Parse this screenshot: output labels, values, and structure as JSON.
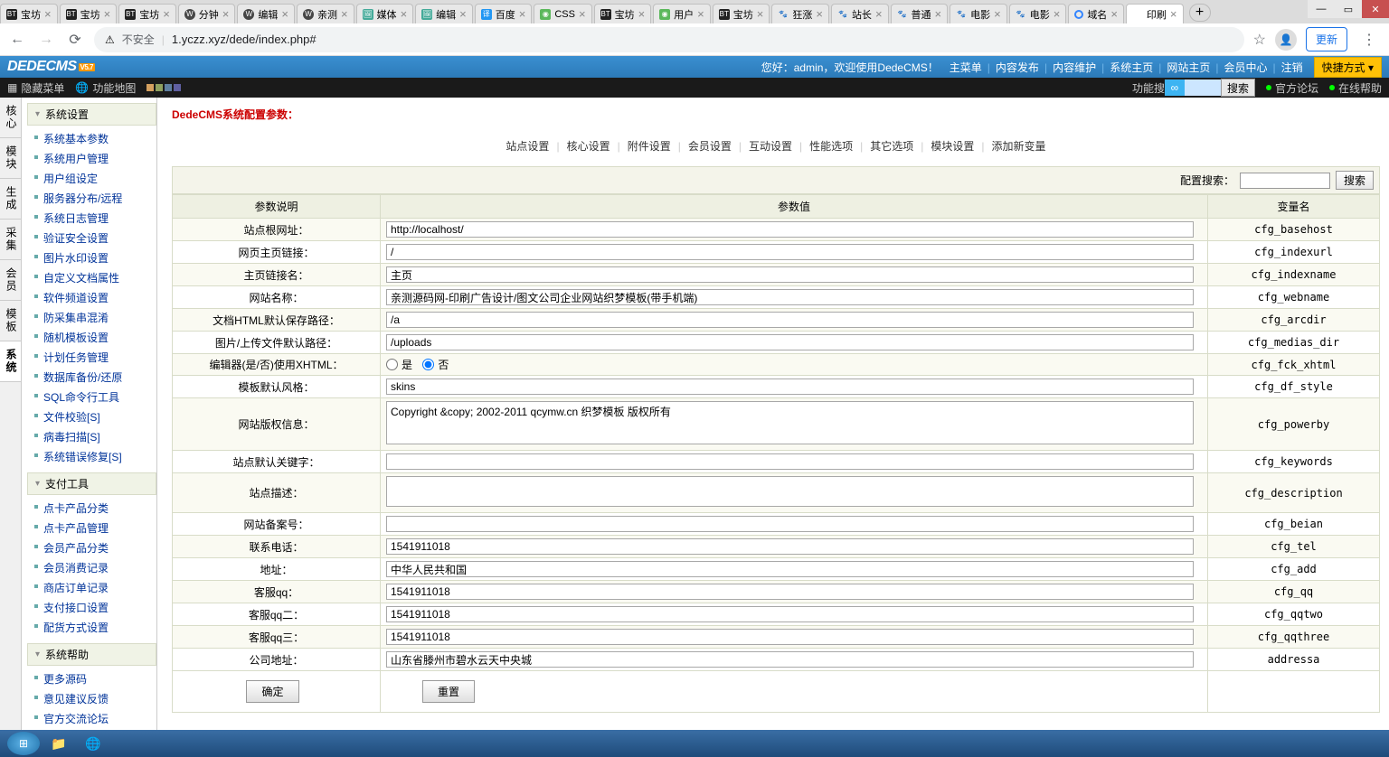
{
  "browser": {
    "tabs": [
      {
        "icon": "bt",
        "title": "宝坊"
      },
      {
        "icon": "bt",
        "title": "宝坊"
      },
      {
        "icon": "bt",
        "title": "宝坊"
      },
      {
        "icon": "wp",
        "title": "分钟"
      },
      {
        "icon": "wp",
        "title": "编辑"
      },
      {
        "icon": "wp",
        "title": "亲测"
      },
      {
        "icon": "img",
        "title": "媒体"
      },
      {
        "icon": "img",
        "title": "编辑"
      },
      {
        "icon": "blue",
        "title": "百度"
      },
      {
        "icon": "green",
        "title": "CSS"
      },
      {
        "icon": "bt",
        "title": "宝坊"
      },
      {
        "icon": "green",
        "title": "用户"
      },
      {
        "icon": "bt",
        "title": "宝坊"
      },
      {
        "icon": "paw",
        "title": "狂涨"
      },
      {
        "icon": "paw",
        "title": "站长"
      },
      {
        "icon": "paw",
        "title": "普通"
      },
      {
        "icon": "paw",
        "title": "电影"
      },
      {
        "icon": "paw",
        "title": "电影"
      },
      {
        "icon": "ring",
        "title": "域名"
      },
      {
        "icon": "",
        "title": "印刷",
        "active": true
      }
    ],
    "insecure_label": "不安全",
    "url": "1.yczz.xyz/dede/index.php#",
    "update_label": "更新"
  },
  "top": {
    "logo_main": "DEDECMS",
    "logo_sub": "V5.7",
    "welcome_prefix": "您好：",
    "user": "admin",
    "welcome_suffix": "，欢迎使用DedeCMS！",
    "links": [
      "主菜单",
      "内容发布",
      "内容维护",
      "系统主页",
      "网站主页",
      "会员中心",
      "注销"
    ],
    "quick": "快捷方式 ▾"
  },
  "toolbar": {
    "hide_menu": "隐藏菜单",
    "sitemap": "功能地图",
    "search_label": "功能搜",
    "search_btn": "搜索",
    "forum": "官方论坛",
    "help": "在线帮助"
  },
  "side_tabs": [
    "核心",
    "模块",
    "生成",
    "采集",
    "会员",
    "模板",
    "系统"
  ],
  "side_active": 6,
  "left_menu": [
    {
      "title": "系统设置",
      "items": [
        "系统基本参数",
        "系统用户管理",
        "用户组设定",
        "服务器分布/远程",
        "系统日志管理",
        "验证安全设置",
        "图片水印设置",
        "自定义文档属性",
        "软件频道设置",
        "防采集串混淆",
        "随机模板设置",
        "计划任务管理",
        "数据库备份/还原",
        "SQL命令行工具",
        "文件校验[S]",
        "病毒扫描[S]",
        "系统错误修复[S]"
      ]
    },
    {
      "title": "支付工具",
      "items": [
        "点卡产品分类",
        "点卡产品管理",
        "会员产品分类",
        "会员消费记录",
        "商店订单记录",
        "支付接口设置",
        "配货方式设置"
      ]
    },
    {
      "title": "系统帮助",
      "items": [
        "更多源码",
        "意见建议反馈",
        "官方交流论坛"
      ]
    }
  ],
  "main": {
    "crumb": "DedeCMS系统配置参数：",
    "subnav": [
      "站点设置",
      "核心设置",
      "附件设置",
      "会员设置",
      "互动设置",
      "性能选项",
      "其它选项",
      "模块设置",
      "添加新变量"
    ],
    "cfg_search_label": "配置搜索：",
    "cfg_search_btn": "搜索",
    "headers": {
      "desc": "参数说明",
      "val": "参数值",
      "var": "变量名"
    },
    "rows": [
      {
        "desc": "站点根网址：",
        "type": "text",
        "value": "http://localhost/",
        "var": "cfg_basehost"
      },
      {
        "desc": "网页主页链接：",
        "type": "text",
        "value": "/",
        "var": "cfg_indexurl"
      },
      {
        "desc": "主页链接名：",
        "type": "text",
        "value": "主页",
        "var": "cfg_indexname"
      },
      {
        "desc": "网站名称：",
        "type": "text",
        "value": "亲测源码网-印刷广告设计/图文公司企业网站织梦模板(带手机端)",
        "var": "cfg_webname"
      },
      {
        "desc": "文档HTML默认保存路径：",
        "type": "text",
        "value": "/a",
        "var": "cfg_arcdir"
      },
      {
        "desc": "图片/上传文件默认路径：",
        "type": "text",
        "value": "/uploads",
        "var": "cfg_medias_dir"
      },
      {
        "desc": "编辑器(是/否)使用XHTML：",
        "type": "radio",
        "yes": "是",
        "no": "否",
        "selected": "no",
        "var": "cfg_fck_xhtml"
      },
      {
        "desc": "模板默认风格：",
        "type": "text",
        "value": "skins",
        "var": "cfg_df_style"
      },
      {
        "desc": "网站版权信息：",
        "type": "textarea",
        "value": "Copyright &copy; 2002-2011 qcymw.cn 织梦模板 版权所有",
        "var": "cfg_powerby"
      },
      {
        "desc": "站点默认关键字：",
        "type": "text",
        "value": "",
        "var": "cfg_keywords"
      },
      {
        "desc": "站点描述：",
        "type": "textarea",
        "value": "",
        "var": "cfg_description"
      },
      {
        "desc": "网站备案号：",
        "type": "text",
        "value": "",
        "var": "cfg_beian"
      },
      {
        "desc": "联系电话：",
        "type": "text",
        "value": "1541911018",
        "var": "cfg_tel"
      },
      {
        "desc": "地址：",
        "type": "text",
        "value": "中华人民共和国",
        "var": "cfg_add"
      },
      {
        "desc": "客服qq：",
        "type": "text",
        "value": "1541911018",
        "var": "cfg_qq"
      },
      {
        "desc": "客服qq二：",
        "type": "text",
        "value": "1541911018",
        "var": "cfg_qqtwo"
      },
      {
        "desc": "客服qq三：",
        "type": "text",
        "value": "1541911018",
        "var": "cfg_qqthree"
      },
      {
        "desc": "公司地址：",
        "type": "text",
        "value": "山东省滕州市碧水云天中央城",
        "var": "addressa"
      }
    ],
    "submit": "确定",
    "reset": "重置"
  }
}
